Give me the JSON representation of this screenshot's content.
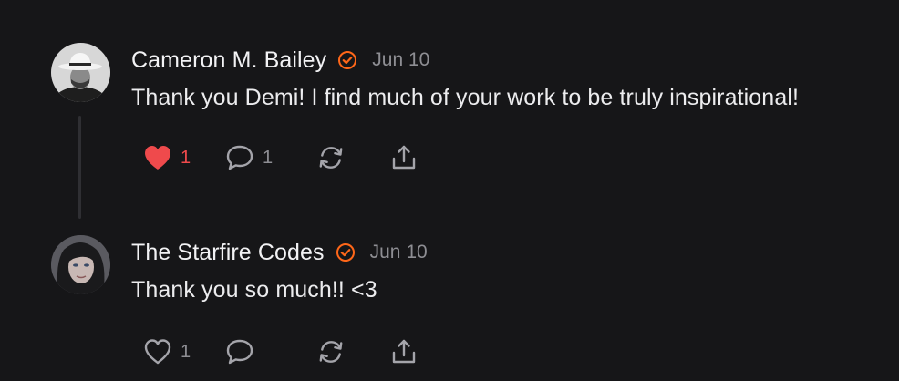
{
  "comments": [
    {
      "author": "Cameron M. Bailey",
      "date": "Jun 10",
      "text": "Thank you Demi! I find much of your work to be truly inspirational!",
      "likes": "1",
      "liked": true,
      "replies": "1"
    },
    {
      "author": "The Starfire Codes",
      "date": "Jun 10",
      "text": "Thank you so much!! <3",
      "likes": "1",
      "liked": false,
      "replies": ""
    }
  ],
  "colors": {
    "background": "#161618",
    "verified_badge": "#ff6719",
    "like_active": "#ef4a4c",
    "muted_text": "#8e8e93"
  },
  "icons": [
    "avatar",
    "verified-badge-icon",
    "heart-icon",
    "comment-icon",
    "restack-icon",
    "share-icon"
  ]
}
